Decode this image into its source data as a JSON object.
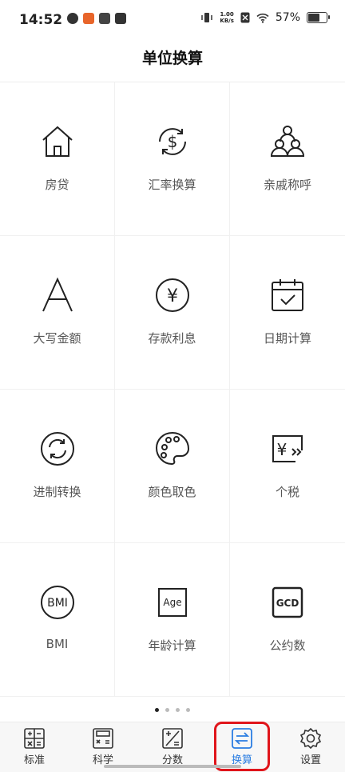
{
  "status": {
    "time": "14:52",
    "speed_top": "1.00",
    "speed_bottom": "KB/s",
    "battery": "57%",
    "battery_level": 0.57
  },
  "header": {
    "title": "单位换算"
  },
  "tools": [
    {
      "label": "房贷",
      "icon": "house-icon"
    },
    {
      "label": "汇率换算",
      "icon": "currency-exchange-icon"
    },
    {
      "label": "亲戚称呼",
      "icon": "family-icon"
    },
    {
      "label": "大写金额",
      "icon": "letter-a-icon"
    },
    {
      "label": "存款利息",
      "icon": "yuan-coin-icon"
    },
    {
      "label": "日期计算",
      "icon": "calendar-check-icon"
    },
    {
      "label": "进制转换",
      "icon": "refresh-icon"
    },
    {
      "label": "颜色取色",
      "icon": "palette-icon"
    },
    {
      "label": "个税",
      "icon": "tax-icon"
    },
    {
      "label": "BMI",
      "icon": "bmi-icon"
    },
    {
      "label": "年龄计算",
      "icon": "age-icon"
    },
    {
      "label": "公约数",
      "icon": "gcd-icon"
    }
  ],
  "icon_text": {
    "bmi": "BMI",
    "age": "Age",
    "gcd": "GCD",
    "yuan": "¥",
    "dollar": "$"
  },
  "pager": {
    "pages": 4,
    "current": 1
  },
  "nav": [
    {
      "label": "标准",
      "icon": "standard-calc-icon"
    },
    {
      "label": "科学",
      "icon": "scientific-calc-icon"
    },
    {
      "label": "分数",
      "icon": "fraction-icon"
    },
    {
      "label": "换算",
      "icon": "convert-icon",
      "active": true
    },
    {
      "label": "设置",
      "icon": "settings-icon"
    }
  ],
  "colors": {
    "accent": "#2b7de1",
    "highlight": "#e0151b"
  }
}
